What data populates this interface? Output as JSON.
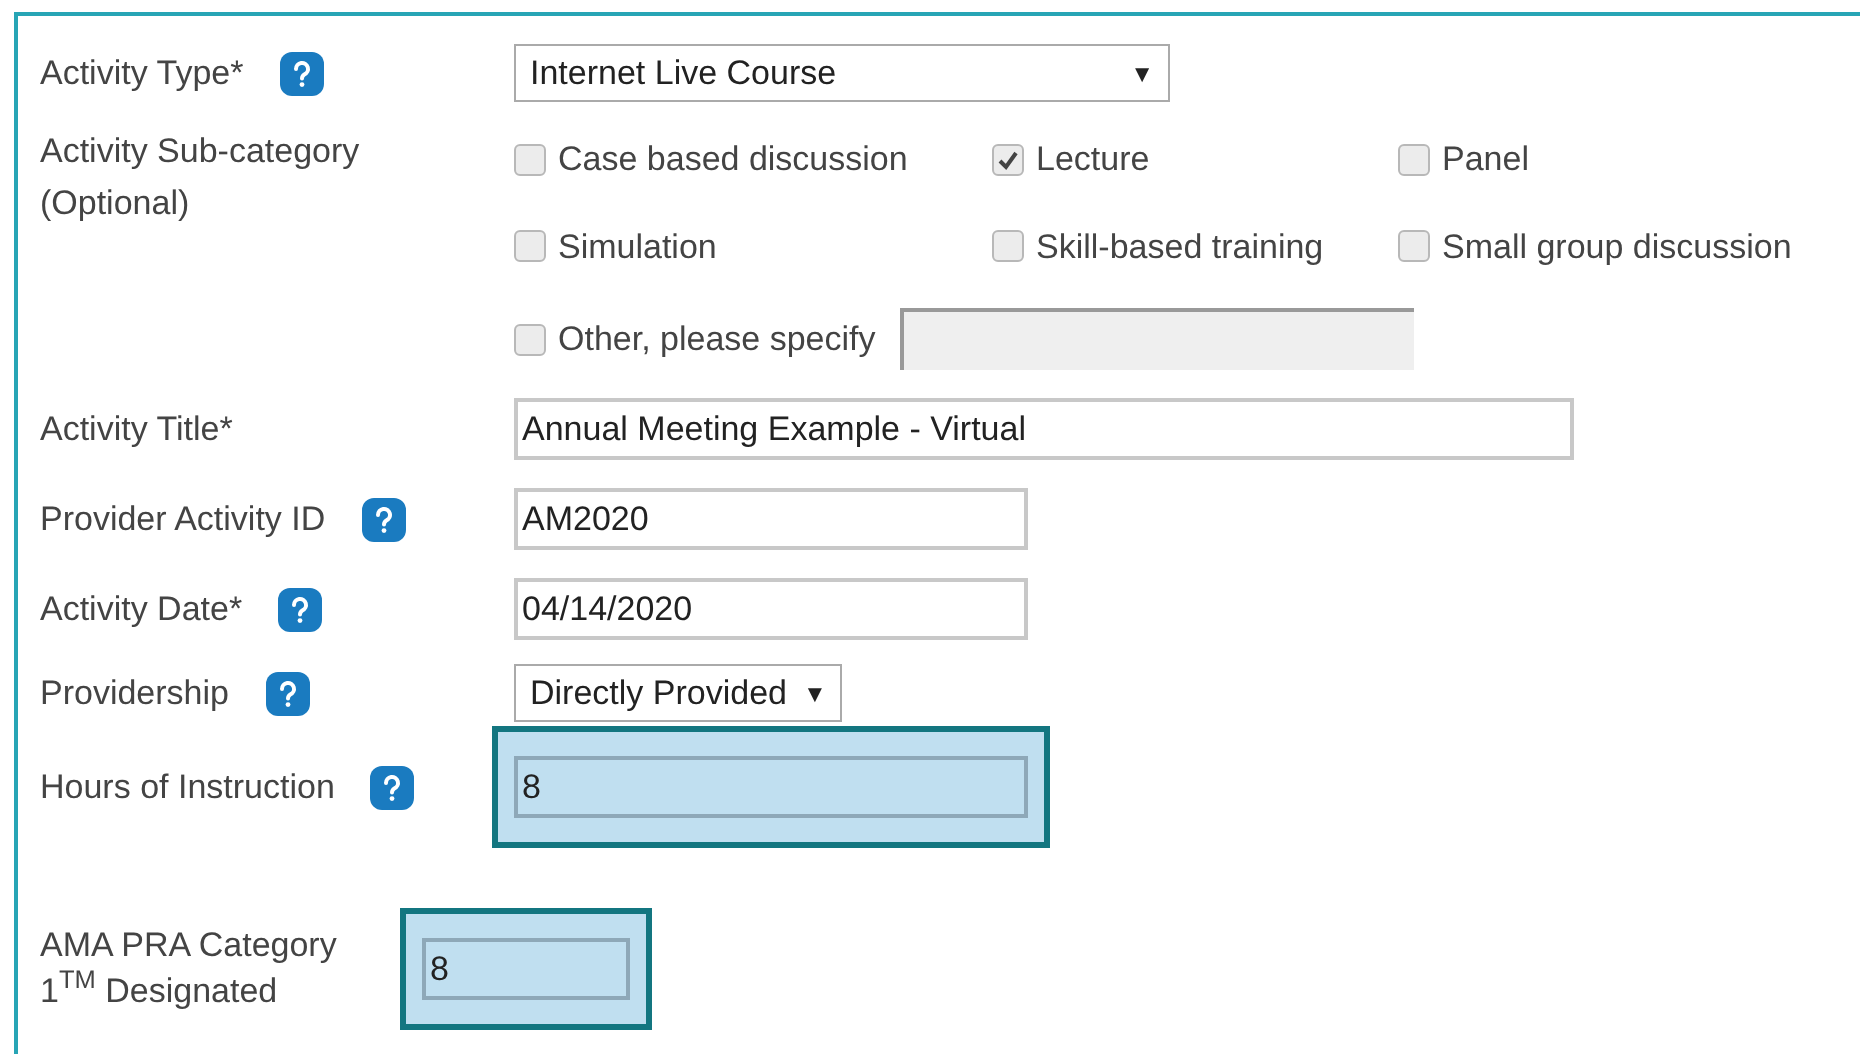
{
  "fields": [
    {
      "kind": "select",
      "label": "Activity Type*",
      "help": true,
      "value": "Internet Live Course",
      "arrow": "▼",
      "highlighted": false
    },
    {
      "kind": "checkboxes",
      "label": "Activity Sub-category (Optional)",
      "help": false,
      "options": [
        {
          "kind": "checkbox",
          "label": "Case based discussion",
          "checked": false
        },
        {
          "kind": "checkbox",
          "label": "Lecture",
          "checked": true
        },
        {
          "kind": "checkbox",
          "label": "Panel",
          "checked": false
        },
        {
          "kind": "checkbox",
          "label": "Simulation",
          "checked": false
        },
        {
          "kind": "checkbox",
          "label": "Skill-based training",
          "checked": false
        },
        {
          "kind": "checkbox",
          "label": "Small group discussion",
          "checked": false
        },
        {
          "kind": "checkbox_with_field",
          "label": "Other, please specify",
          "checked": false
        }
      ],
      "highlighted": false
    },
    {
      "kind": "wide_text",
      "label": "Activity Title*",
      "help": false,
      "value": "Annual Meeting Example - Virtual",
      "highlighted": false
    },
    {
      "kind": "text",
      "label": "Provider Activity ID",
      "help": true,
      "value": "AM2020",
      "highlighted": false
    },
    {
      "kind": "text",
      "label": "Activity Date*",
      "help": true,
      "value": "04/14/2020",
      "highlighted": false
    },
    {
      "kind": "select",
      "label": "Providership",
      "help": true,
      "value": "Directly Provided",
      "arrow": "▼",
      "highlighted": false
    },
    {
      "kind": "text",
      "label": "Hours of Instruction",
      "help": true,
      "value": "8",
      "highlighted": true
    },
    {
      "kind": "compact",
      "label": "AMA PRA Category 1$^{TM}$ Designated",
      "help": false,
      "value": "8",
      "highlighted": true
    }
  ]
}
